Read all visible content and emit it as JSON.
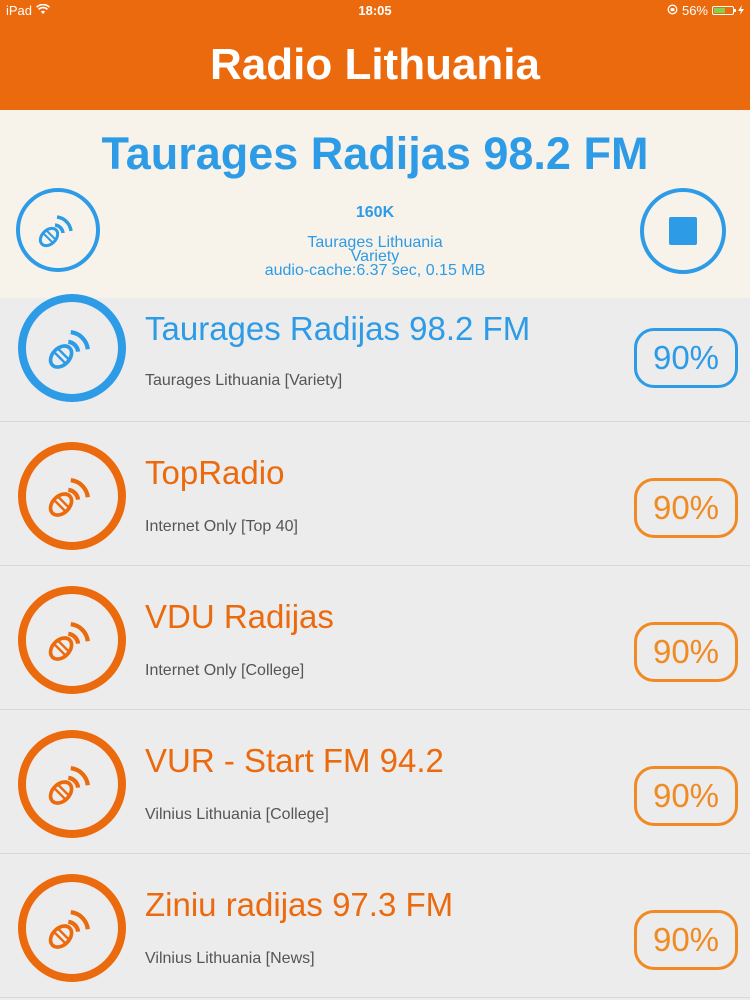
{
  "status_bar": {
    "device": "iPad",
    "time": "18:05",
    "battery": "56%"
  },
  "header": {
    "title": "Radio Lithuania"
  },
  "now_playing": {
    "title": "Taurages Radijas 98.2 FM",
    "bitrate": "160K",
    "location": "Taurages Lithuania",
    "genre": "Variety",
    "cache": "audio-cache:6.37 sec, 0.15 MB"
  },
  "stations": [
    {
      "name": "Taurages Radijas 98.2 FM",
      "subtitle": "Taurages Lithuania [Variety]",
      "percent": "90%",
      "active": true
    },
    {
      "name": "TopRadio",
      "subtitle": "Internet Only [Top 40]",
      "percent": "90%",
      "active": false
    },
    {
      "name": "VDU Radijas",
      "subtitle": "Internet Only [College]",
      "percent": "90%",
      "active": false
    },
    {
      "name": "VUR - Start FM 94.2",
      "subtitle": "Vilnius Lithuania [College]",
      "percent": "90%",
      "active": false
    },
    {
      "name": "Ziniu radijas 97.3 FM",
      "subtitle": "Vilnius Lithuania [News]",
      "percent": "90%",
      "active": false
    }
  ],
  "colors": {
    "orange": "#ec6a0e",
    "blue": "#2d9be6",
    "light_orange": "#f08a24"
  },
  "icons": {
    "station": "radio-waves-icon",
    "stop": "stop-icon",
    "wifi": "wifi-icon",
    "battery": "battery-icon"
  }
}
